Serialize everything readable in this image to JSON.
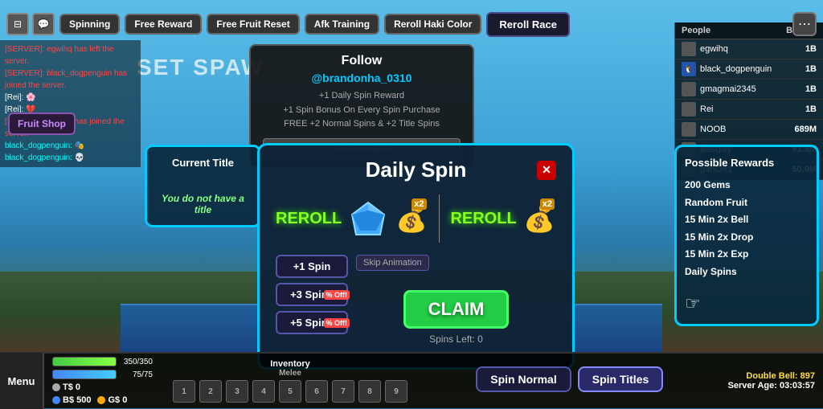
{
  "game": {
    "title": "Daily Spin"
  },
  "topbar": {
    "buttons": [
      "Spinning",
      "Free Reward",
      "Free Fruit Reset",
      "Afk Training",
      "Reroll Haki Color"
    ],
    "reroll_race": "Reroll Race",
    "fruit_shop": "Fruit Shop"
  },
  "follow_box": {
    "title": "Follow",
    "username": "@brandonha_0310",
    "line1": "+1 Daily Spin Reward",
    "line2": "+1 Spin Bonus On Every Spin Purchase",
    "line3": "FREE +2 Normal Spins & +2 Title Spins",
    "button": "Account Name"
  },
  "set_spawn": "SET SPAW",
  "chat": {
    "messages": [
      {
        "color": "red",
        "text": "[SERVER]: egwihq has left the server."
      },
      {
        "color": "red",
        "text": "[SERVER]: black_dogpenguin has joined the server."
      },
      {
        "color": "white",
        "text": "[Rei]: 🌸"
      },
      {
        "color": "white",
        "text": "[Rei]: 💔"
      },
      {
        "color": "red",
        "text": "[SERVER]: egwihq has joined the server."
      },
      {
        "color": "cyan",
        "text": "black_dogpenguin: 🎭"
      },
      {
        "color": "cyan",
        "text": "black_dogpenguin: 💀"
      }
    ]
  },
  "current_title": {
    "header": "Current Title",
    "no_title": "You do not have a title"
  },
  "daily_spin": {
    "title": "Daily Spin",
    "close": "✕",
    "skip_animation": "Skip Animation",
    "claim": "CLAIM",
    "spins_left": "Spins Left: 0",
    "spin_buttons": [
      "+1 Spin",
      "+3 Spins",
      "+5 Spins"
    ],
    "sale_labels": [
      "",
      "% Off!",
      "% Off!"
    ]
  },
  "rewards": {
    "header": "Possible Rewards",
    "items": [
      "200 Gems",
      "Random Fruit",
      "15 Min 2x Bell",
      "15 Min 2x Drop",
      "15 Min 2x Exp",
      "Daily Spins"
    ]
  },
  "leaderboard": {
    "col1": "People",
    "col2": "Bounty",
    "rows": [
      {
        "name": "egwihq",
        "bounty": "1B",
        "has_avatar": false
      },
      {
        "name": "black_dogpenguin",
        "bounty": "1B",
        "has_avatar": true
      },
      {
        "name": "gmagmai2345",
        "bounty": "1B",
        "has_avatar": false
      },
      {
        "name": "Rei",
        "bounty": "1B",
        "has_avatar": false
      },
      {
        "name": "NOOB",
        "bounty": "689M",
        "has_avatar": false
      },
      {
        "name": "jessgwy",
        "bounty": "91.5M",
        "has_avatar": false
      },
      {
        "name": "ganOrr1",
        "bounty": "50.9M",
        "has_avatar": false
      }
    ]
  },
  "bottom": {
    "health": "350/350",
    "stamina": "75/75",
    "ts": "T$ 0",
    "bs": "B$ 500",
    "gs": "G$ 0",
    "inventory": "Inventory",
    "melee_label": "Melee",
    "melee_slots": [
      "1",
      "2",
      "3",
      "4",
      "5",
      "6",
      "7",
      "8",
      "9"
    ],
    "tab_normal": "Spin Normal",
    "tab_titles": "Spin Titles",
    "double_bell": "Double Bell: 897",
    "server_age": "Server Age: 03:03:57"
  }
}
